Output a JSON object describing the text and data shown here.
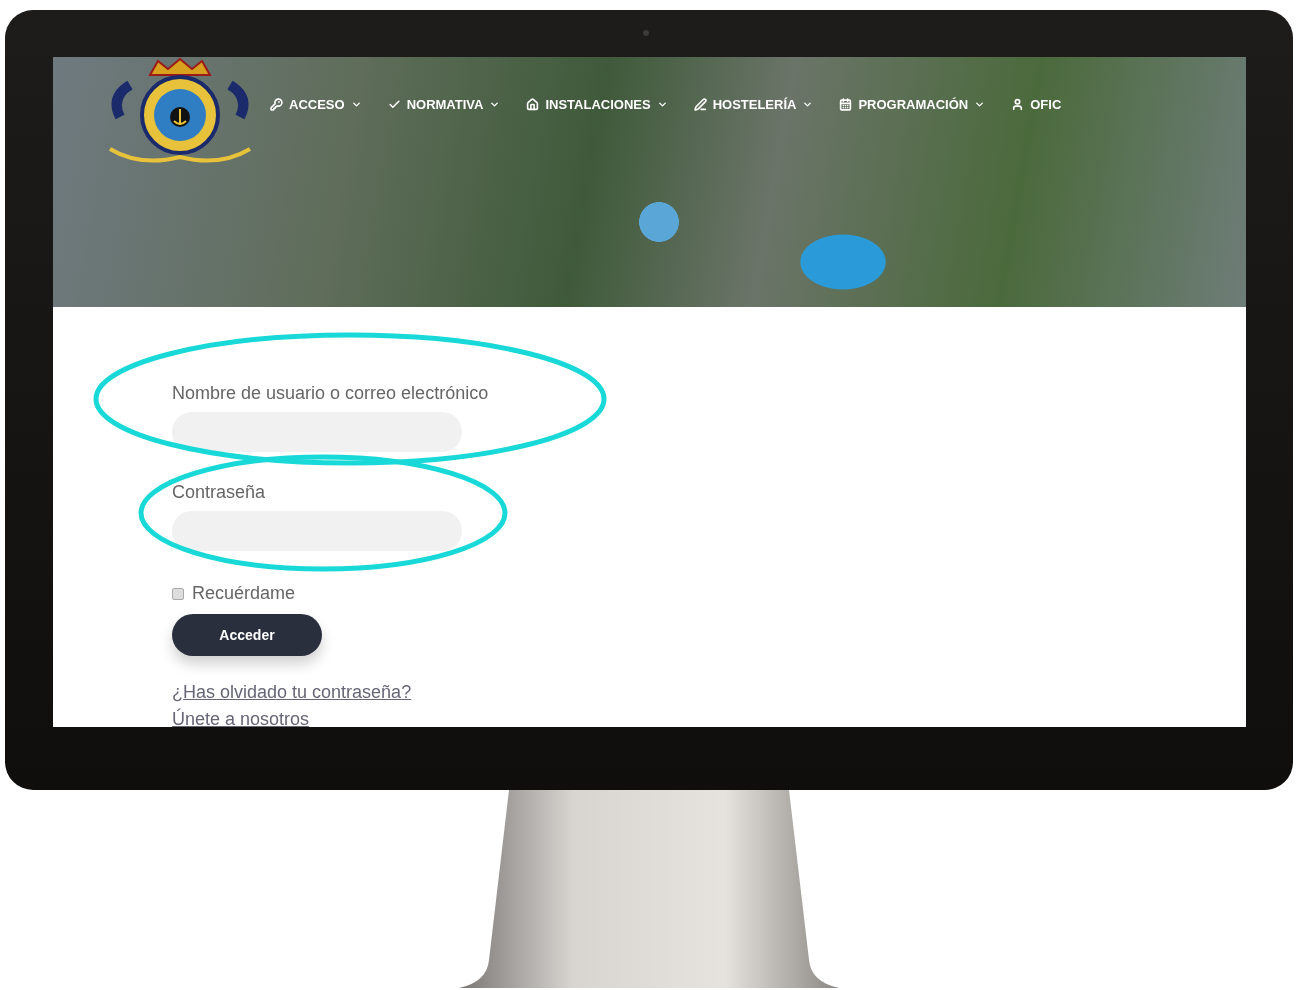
{
  "nav": {
    "items": [
      {
        "label": "ACCESO"
      },
      {
        "label": "NORMATIVA"
      },
      {
        "label": "INSTALACIONES"
      },
      {
        "label": "HOSTELERÍA"
      },
      {
        "label": "PROGRAMACIÓN"
      },
      {
        "label": "OFIC",
        "caret": false
      }
    ]
  },
  "login_form": {
    "username_label": "Nombre de usuario o correo electrónico",
    "password_label": "Contraseña",
    "remember": {
      "label": "Recuérdame",
      "checked": false
    },
    "submit": "Acceder",
    "links": [
      "¿Has olvidado tu contraseña?",
      "Únete a nosotros"
    ]
  },
  "annotations": [
    {
      "kind": "ellipse"
    },
    {
      "kind": "ellipse"
    }
  ]
}
